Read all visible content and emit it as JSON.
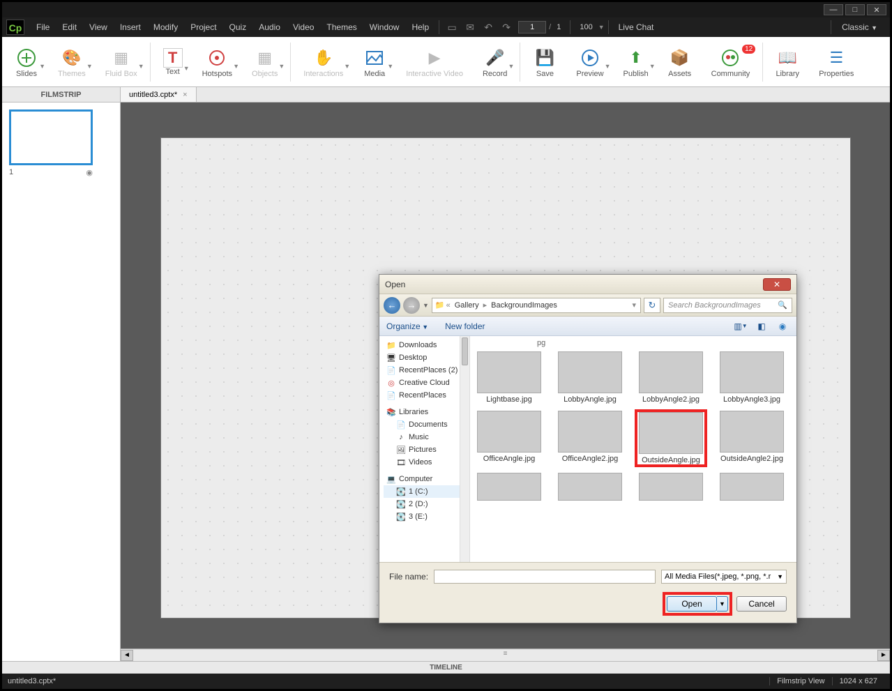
{
  "menubar": {
    "items": [
      "File",
      "Edit",
      "View",
      "Insert",
      "Modify",
      "Project",
      "Quiz",
      "Audio",
      "Video",
      "Themes",
      "Window",
      "Help"
    ],
    "page_current": "1",
    "page_sep": "/",
    "page_total": "1",
    "zoom": "100",
    "live_chat": "Live Chat",
    "classic": "Classic"
  },
  "ribbon": {
    "slides": "Slides",
    "themes": "Themes",
    "fluid": "Fluid Box",
    "text": "Text",
    "hotspots": "Hotspots",
    "objects": "Objects",
    "interactions": "Interactions",
    "media": "Media",
    "ivideo": "Interactive Video",
    "record": "Record",
    "save": "Save",
    "preview": "Preview",
    "publish": "Publish",
    "assets": "Assets",
    "community": "Community",
    "community_badge": "12",
    "library": "Library",
    "properties": "Properties"
  },
  "docstrip": {
    "filmstrip": "FILMSTRIP",
    "tab_name": "untitled3.cptx*"
  },
  "filmstrip": {
    "slide_num": "1"
  },
  "timeline": {
    "label": "TIMELINE"
  },
  "status": {
    "file": "untitled3.cptx*",
    "view": "Filmstrip View",
    "dims": "1024 x 627"
  },
  "dialog": {
    "title": "Open",
    "breadcrumb": {
      "gallery": "Gallery",
      "folder": "BackgroundImages"
    },
    "search_placeholder": "Search BackgroundImages",
    "organize": "Organize",
    "newfolder": "New folder",
    "tree": {
      "downloads": "Downloads",
      "desktop": "Desktop",
      "recent2": "RecentPlaces (2)",
      "cc": "Creative Cloud",
      "recent": "RecentPlaces",
      "libraries": "Libraries",
      "documents": "Documents",
      "music": "Music",
      "pictures": "Pictures",
      "videos": "Videos",
      "computer": "Computer",
      "c": "1 (C:)",
      "d": "2 (D:)",
      "e": "3 (E:)"
    },
    "files": {
      "pg": "pg",
      "r1": [
        "Lightbase.jpg",
        "LobbyAngle.jpg",
        "LobbyAngle2.jpg",
        "LobbyAngle3.jpg"
      ],
      "r2": [
        "OfficeAngle.jpg",
        "OfficeAngle2.jpg",
        "OutsideAngle.jpg",
        "OutsideAngle2.jpg"
      ]
    },
    "file_name_label": "File name:",
    "filter": "All Media Files(*.jpeg, *.png, *.r",
    "open": "Open",
    "cancel": "Cancel"
  }
}
